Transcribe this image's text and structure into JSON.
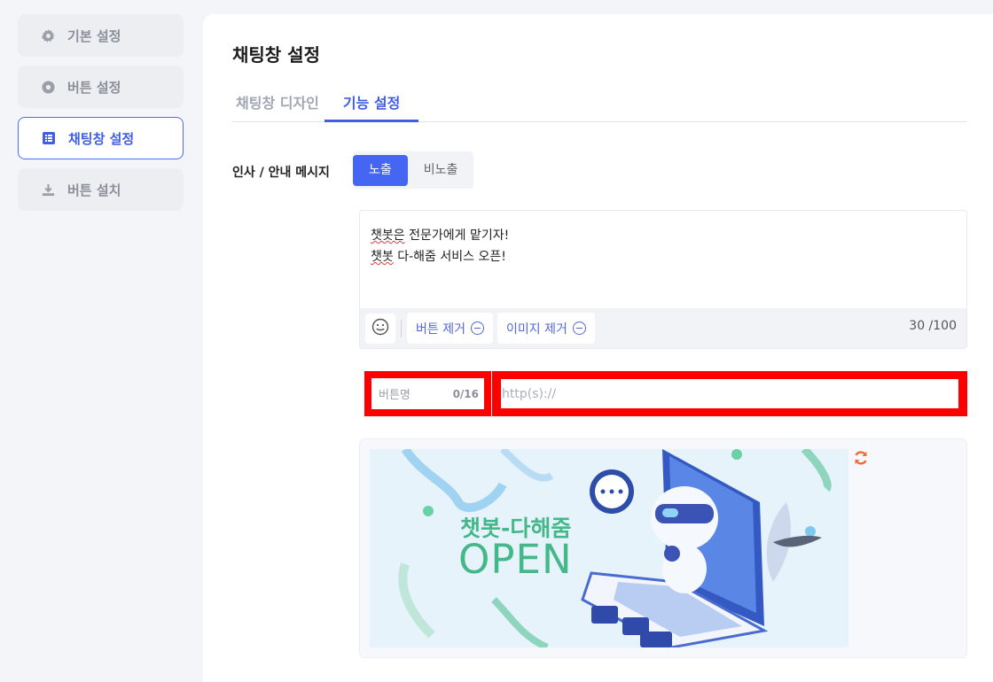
{
  "sidebar": {
    "items": [
      {
        "label": "기본 설정",
        "icon": "gear-icon"
      },
      {
        "label": "버튼 설정",
        "icon": "record-icon"
      },
      {
        "label": "채팅창 설정",
        "icon": "list-icon"
      },
      {
        "label": "버튼 설치",
        "icon": "download-icon"
      }
    ],
    "active_index": 2
  },
  "page": {
    "title": "채팅창 설정",
    "tabs": [
      {
        "label": "채팅창 디자인",
        "active": false
      },
      {
        "label": "기능 설정",
        "active": true
      }
    ]
  },
  "greeting": {
    "label": "인사 / 안내 메시지",
    "toggle": {
      "on_label": "노출",
      "off_label": "비노출",
      "selected": "노출"
    },
    "message_line1_word": "챗봇은",
    "message_line1_rest": " 전문가에게 맡기자!",
    "message_line2_word": "챗봇",
    "message_line2_rest": " 다-해줌 서비스 오픈!",
    "remove_button_label": "버튼 제거",
    "remove_image_label": "이미지 제거",
    "char_count": "30 /100"
  },
  "button_fields": {
    "name_placeholder": "버튼명",
    "name_count": "0/16",
    "url_placeholder": "http(s)://"
  },
  "banner": {
    "title": "챗봇-다해줌",
    "subtitle": "OPEN"
  },
  "colors": {
    "accent": "#4466f2",
    "highlight": "#ff0000",
    "banner_text": "#45b88a",
    "refresh": "#f06a3a"
  }
}
